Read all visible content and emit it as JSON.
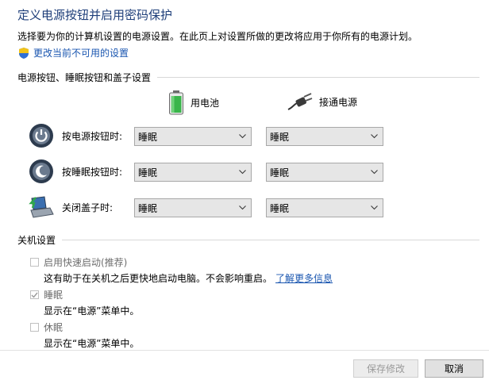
{
  "header": {
    "title": "定义电源按钮并启用密码保护",
    "description": "选择要为你的计算机设置的电源设置。在此页上对设置所做的更改将应用于你所有的电源计划。",
    "change_link": "更改当前不可用的设置"
  },
  "power_section": {
    "title": "电源按钮、睡眠按钮和盖子设置",
    "col_battery": "用电池",
    "col_plugged": "接通电源",
    "rows": [
      {
        "label": "按电源按钮时:",
        "battery": "睡眠",
        "plugged": "睡眠"
      },
      {
        "label": "按睡眠按钮时:",
        "battery": "睡眠",
        "plugged": "睡眠"
      },
      {
        "label": "关闭盖子时:",
        "battery": "睡眠",
        "plugged": "睡眠"
      }
    ]
  },
  "shutdown_section": {
    "title": "关机设置",
    "items": [
      {
        "label": "启用快速启动(推荐)",
        "checked": false,
        "desc": "这有助于在关机之后更快地启动电脑。不会影响重启。",
        "link": "了解更多信息"
      },
      {
        "label": "睡眠",
        "checked": true,
        "desc": "显示在“电源”菜单中。"
      },
      {
        "label": "休眠",
        "checked": false,
        "desc": "显示在“电源”菜单中。"
      }
    ]
  },
  "footer": {
    "save_label": "保存修改",
    "cancel_label": "取消"
  },
  "colors": {
    "title": "#1f3f7a",
    "link": "#1a56b0"
  }
}
